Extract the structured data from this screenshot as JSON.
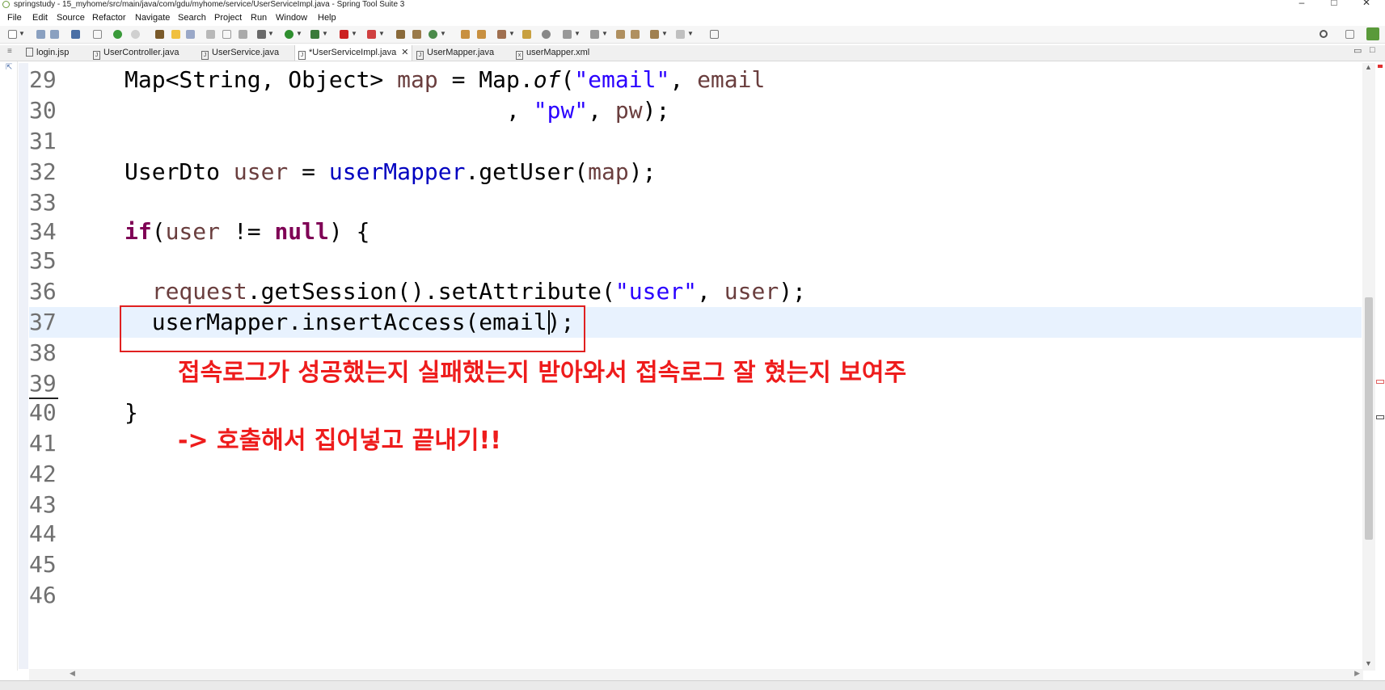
{
  "window": {
    "title": "springstudy - 15_myhome/src/main/java/com/gdu/myhome/service/UserServiceImpl.java - Spring Tool Suite 3",
    "controls": [
      "–",
      "□",
      "✕"
    ]
  },
  "menu": [
    "File",
    "Edit",
    "Source",
    "Refactor",
    "Navigate",
    "Search",
    "Project",
    "Run",
    "Window",
    "Help"
  ],
  "tabs": [
    {
      "label": "login.jsp",
      "icon": "file-icon",
      "active": false
    },
    {
      "label": "UserController.java",
      "icon": "java-file-icon",
      "active": false
    },
    {
      "label": "UserService.java",
      "icon": "java-file-icon",
      "active": false
    },
    {
      "label": "*UserServiceImpl.java",
      "icon": "java-file-icon",
      "active": true,
      "close": "✕"
    },
    {
      "label": "UserMapper.java",
      "icon": "java-file-icon",
      "active": false
    },
    {
      "label": "userMapper.xml",
      "icon": "xml-file-icon",
      "active": false
    }
  ],
  "editor": {
    "line_numbers": [
      "29",
      "30",
      "31",
      "32",
      "33",
      "34",
      "35",
      "36",
      "37",
      "38",
      "39",
      "40",
      "41",
      "42",
      "43",
      "44",
      "45",
      "46"
    ],
    "current_line": "37",
    "error_line": "37",
    "annotation_line1": "접속로그가 성공했는지 실패했는지 받아와서 접속로그 잘 혔는지 보여주",
    "annotation_line2": "-> 호출해서 집어넣고 끝내기!!"
  },
  "colors": {
    "keyword": "#7f0055",
    "string": "#2a00ff",
    "field": "#0000c0",
    "local_var": "#6a3e3e",
    "annotation": "#ee1c1c",
    "current_line_bg": "#e8f2fe"
  }
}
